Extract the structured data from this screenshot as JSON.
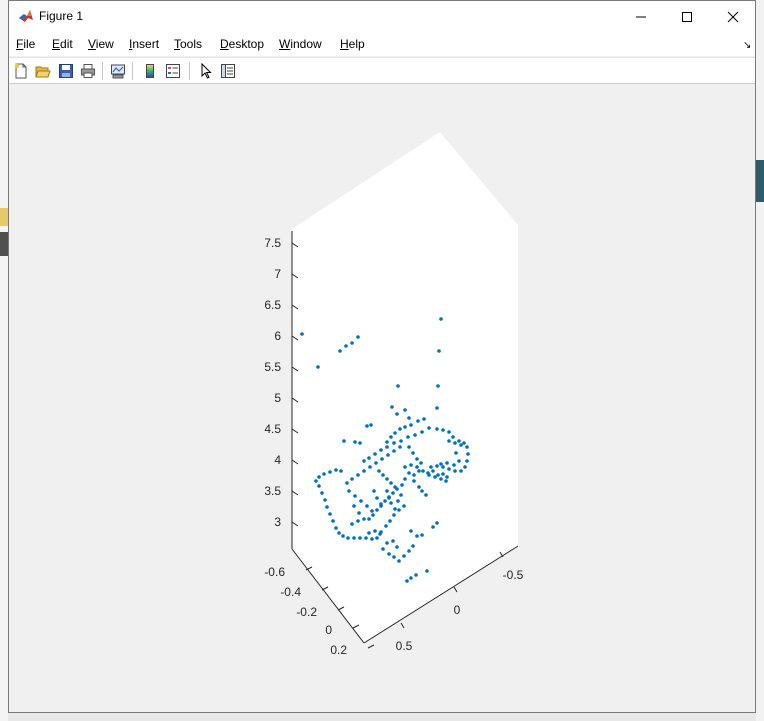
{
  "window": {
    "title": "Figure 1",
    "controls": {
      "minimize": "minimize",
      "maximize": "maximize",
      "close": "close"
    }
  },
  "menu": {
    "items": [
      "File",
      "Edit",
      "View",
      "Insert",
      "Tools",
      "Desktop",
      "Window",
      "Help"
    ]
  },
  "toolbar": {
    "buttons": [
      "new-figure-icon",
      "open-file-icon",
      "save-icon",
      "print-icon",
      "link-plot-icon",
      "colorbar-icon",
      "legend-icon",
      "pointer-icon",
      "property-inspector-icon"
    ]
  },
  "colors": {
    "marker": "#0072bd",
    "axes_background": "#ffffff",
    "figure_background": "#f0f0f0"
  },
  "chart_data": {
    "type": "scatter",
    "dimensions": 3,
    "z_ticks": [
      "3",
      "3.5",
      "4",
      "4.5",
      "5",
      "5.5",
      "6",
      "6.5",
      "7",
      "7.5"
    ],
    "x_ticks": [
      "-0.6",
      "-0.4",
      "-0.2",
      "0",
      "0.2"
    ],
    "y_ticks": [
      "-0.5",
      "0",
      "0.5"
    ],
    "zlim": [
      2.6,
      7.7
    ],
    "grid": false,
    "points_screen": [
      [
        293,
        333
      ],
      [
        309,
        366
      ],
      [
        331,
        350
      ],
      [
        337,
        345
      ],
      [
        343,
        342
      ],
      [
        349,
        336
      ],
      [
        432,
        318
      ],
      [
        430,
        350
      ],
      [
        429,
        385
      ],
      [
        389,
        385
      ],
      [
        383,
        406
      ],
      [
        388,
        413
      ],
      [
        396,
        409
      ],
      [
        400,
        417
      ],
      [
        409,
        420
      ],
      [
        415,
        418
      ],
      [
        428,
        407
      ],
      [
        358,
        425
      ],
      [
        362,
        424
      ],
      [
        335,
        440
      ],
      [
        346,
        441
      ],
      [
        351,
        442
      ],
      [
        378,
        441
      ],
      [
        382,
        436
      ],
      [
        386,
        432
      ],
      [
        391,
        428
      ],
      [
        396,
        426
      ],
      [
        402,
        424
      ],
      [
        307,
        480
      ],
      [
        310,
        485
      ],
      [
        313,
        492
      ],
      [
        316,
        499
      ],
      [
        318,
        506
      ],
      [
        321,
        513
      ],
      [
        324,
        520
      ],
      [
        327,
        527
      ],
      [
        330,
        532
      ],
      [
        334,
        535
      ],
      [
        339,
        537
      ],
      [
        345,
        537
      ],
      [
        351,
        537
      ],
      [
        357,
        537
      ],
      [
        363,
        538
      ],
      [
        368,
        537
      ],
      [
        372,
        531
      ],
      [
        377,
        525
      ],
      [
        381,
        520
      ],
      [
        385,
        514
      ],
      [
        390,
        509
      ],
      [
        395,
        505
      ],
      [
        310,
        476
      ],
      [
        315,
        473
      ],
      [
        321,
        471
      ],
      [
        327,
        469
      ],
      [
        332,
        470
      ],
      [
        338,
        482
      ],
      [
        343,
        478
      ],
      [
        349,
        474
      ],
      [
        355,
        470
      ],
      [
        361,
        466
      ],
      [
        367,
        462
      ],
      [
        373,
        458
      ],
      [
        379,
        454
      ],
      [
        385,
        450
      ],
      [
        391,
        446
      ],
      [
        340,
        490
      ],
      [
        346,
        495
      ],
      [
        352,
        500
      ],
      [
        358,
        505
      ],
      [
        363,
        510
      ],
      [
        355,
        460
      ],
      [
        360,
        457
      ],
      [
        366,
        453
      ],
      [
        372,
        449
      ],
      [
        378,
        446
      ],
      [
        385,
        442
      ],
      [
        392,
        440
      ],
      [
        399,
        436
      ],
      [
        406,
        434
      ],
      [
        413,
        431
      ],
      [
        420,
        427
      ],
      [
        428,
        428
      ],
      [
        434,
        429
      ],
      [
        440,
        431
      ],
      [
        444,
        436
      ],
      [
        450,
        440
      ],
      [
        455,
        442
      ],
      [
        458,
        446
      ],
      [
        459,
        453
      ],
      [
        458,
        460
      ],
      [
        456,
        466
      ],
      [
        452,
        470
      ],
      [
        446,
        470
      ],
      [
        440,
        468
      ],
      [
        434,
        466
      ],
      [
        428,
        465
      ],
      [
        422,
        466
      ],
      [
        440,
        440
      ],
      [
        446,
        442
      ],
      [
        452,
        444
      ],
      [
        447,
        452
      ],
      [
        450,
        460
      ],
      [
        445,
        464
      ],
      [
        438,
        462
      ],
      [
        432,
        463
      ],
      [
        400,
        446
      ],
      [
        404,
        452
      ],
      [
        408,
        458
      ],
      [
        412,
        462
      ],
      [
        410,
        470
      ],
      [
        405,
        474
      ],
      [
        400,
        472
      ],
      [
        396,
        478
      ],
      [
        393,
        484
      ],
      [
        388,
        488
      ],
      [
        384,
        492
      ],
      [
        380,
        497
      ],
      [
        376,
        500
      ],
      [
        372,
        505
      ],
      [
        368,
        509
      ],
      [
        364,
        514
      ],
      [
        360,
        518
      ],
      [
        370,
        470
      ],
      [
        374,
        474
      ],
      [
        378,
        478
      ],
      [
        382,
        482
      ],
      [
        386,
        486
      ],
      [
        345,
        505
      ],
      [
        350,
        512
      ],
      [
        355,
        518
      ],
      [
        349,
        520
      ],
      [
        343,
        523
      ],
      [
        378,
        490
      ],
      [
        380,
        496
      ],
      [
        382,
        502
      ],
      [
        386,
        508
      ],
      [
        389,
        500
      ],
      [
        392,
        494
      ],
      [
        396,
        466
      ],
      [
        402,
        464
      ],
      [
        408,
        466
      ],
      [
        414,
        470
      ],
      [
        420,
        474
      ],
      [
        426,
        476
      ],
      [
        432,
        478
      ],
      [
        437,
        480
      ],
      [
        405,
        480
      ],
      [
        410,
        486
      ],
      [
        413,
        490
      ],
      [
        417,
        494
      ],
      [
        419,
        472
      ],
      [
        424,
        470
      ],
      [
        429,
        474
      ],
      [
        434,
        473
      ],
      [
        438,
        476
      ],
      [
        365,
        490
      ],
      [
        368,
        497
      ],
      [
        372,
        503
      ],
      [
        378,
        542
      ],
      [
        374,
        548
      ],
      [
        380,
        553
      ],
      [
        385,
        556
      ],
      [
        390,
        560
      ],
      [
        395,
        555
      ],
      [
        400,
        550
      ],
      [
        404,
        545
      ],
      [
        384,
        540
      ],
      [
        388,
        546
      ],
      [
        398,
        580
      ],
      [
        402,
        577
      ],
      [
        407,
        574
      ],
      [
        418,
        570
      ],
      [
        402,
        530
      ],
      [
        408,
        535
      ],
      [
        413,
        534
      ],
      [
        424,
        526
      ],
      [
        428,
        522
      ],
      [
        360,
        532
      ],
      [
        366,
        530
      ],
      [
        371,
        533
      ]
    ]
  }
}
